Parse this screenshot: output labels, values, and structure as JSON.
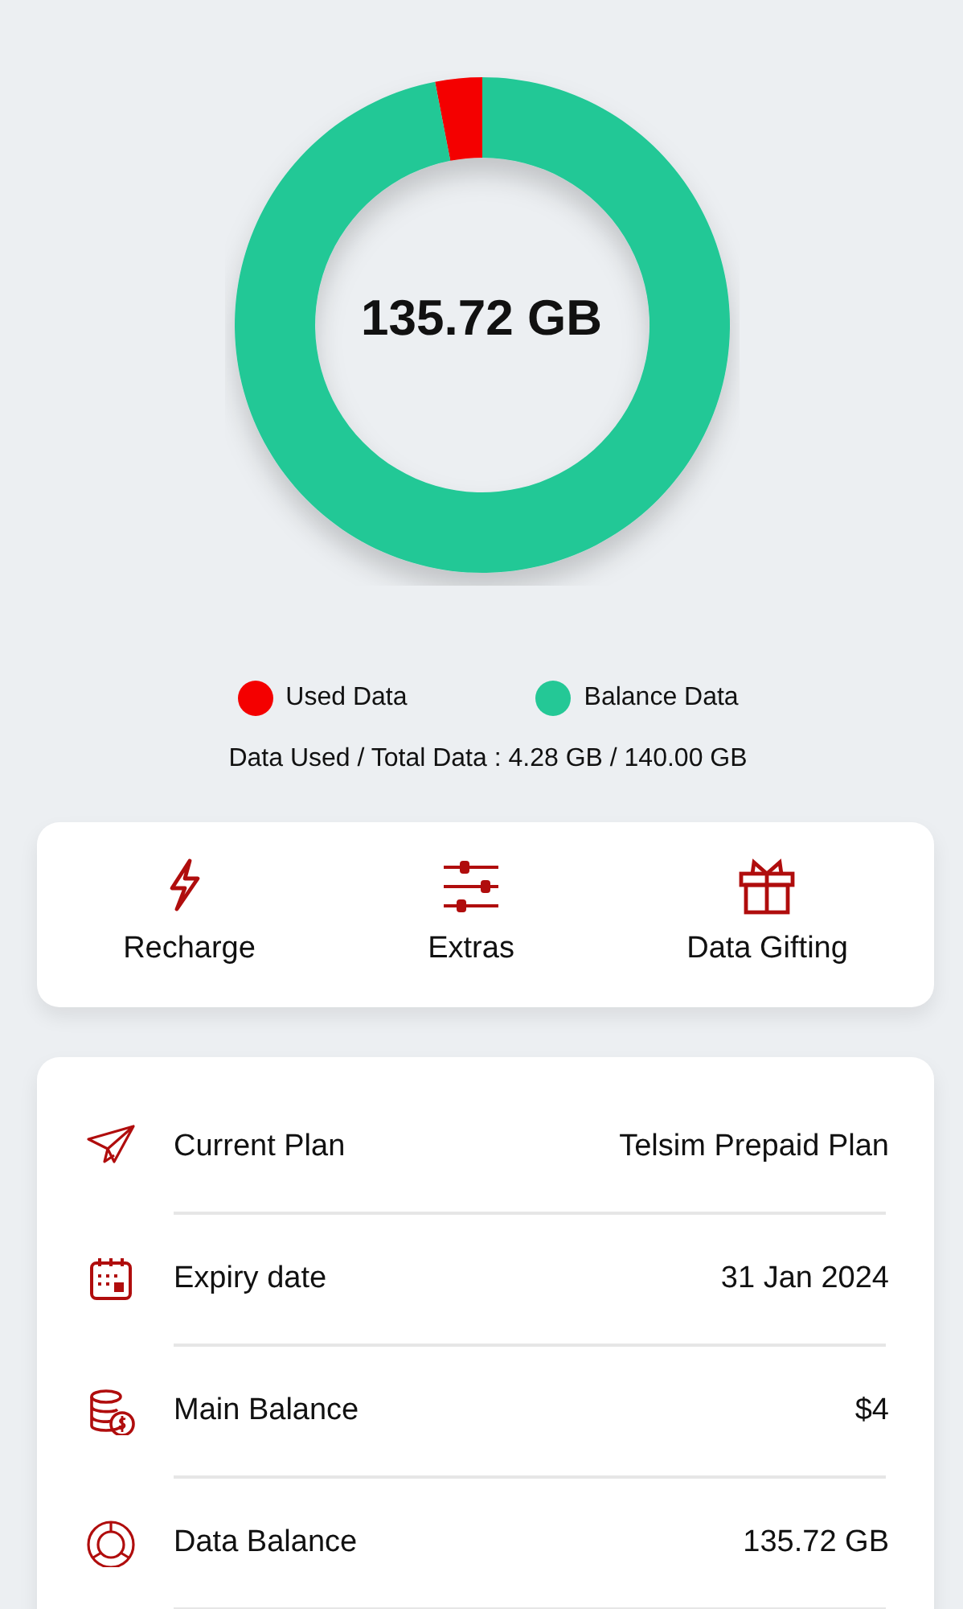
{
  "usage": {
    "center_text": "135.72 GB",
    "chart_data": {
      "type": "donut",
      "categories": [
        "Used Data",
        "Balance Data"
      ],
      "values": [
        3.06,
        96.94
      ]
    },
    "legend": [
      {
        "color": "#f40000"
      },
      {
        "color": "#24c896"
      }
    ],
    "summary": "Data Used / Total Data : 4.28 GB / 140.00 GB"
  },
  "actions": [
    {
      "kind": "bolt",
      "label": "Recharge"
    },
    {
      "kind": "sliders",
      "label": "Extras"
    },
    {
      "kind": "gift",
      "label": "Data Gifting"
    }
  ],
  "details": [
    {
      "kind": "plane",
      "label": "Current Plan",
      "value": "Telsim Prepaid Plan"
    },
    {
      "kind": "calendar",
      "label": "Expiry date",
      "value": "31 Jan 2024"
    },
    {
      "kind": "coins",
      "label": "Main Balance",
      "value": "$4"
    },
    {
      "kind": "ring",
      "label": "Data Balance",
      "value": "135.72 GB"
    }
  ]
}
